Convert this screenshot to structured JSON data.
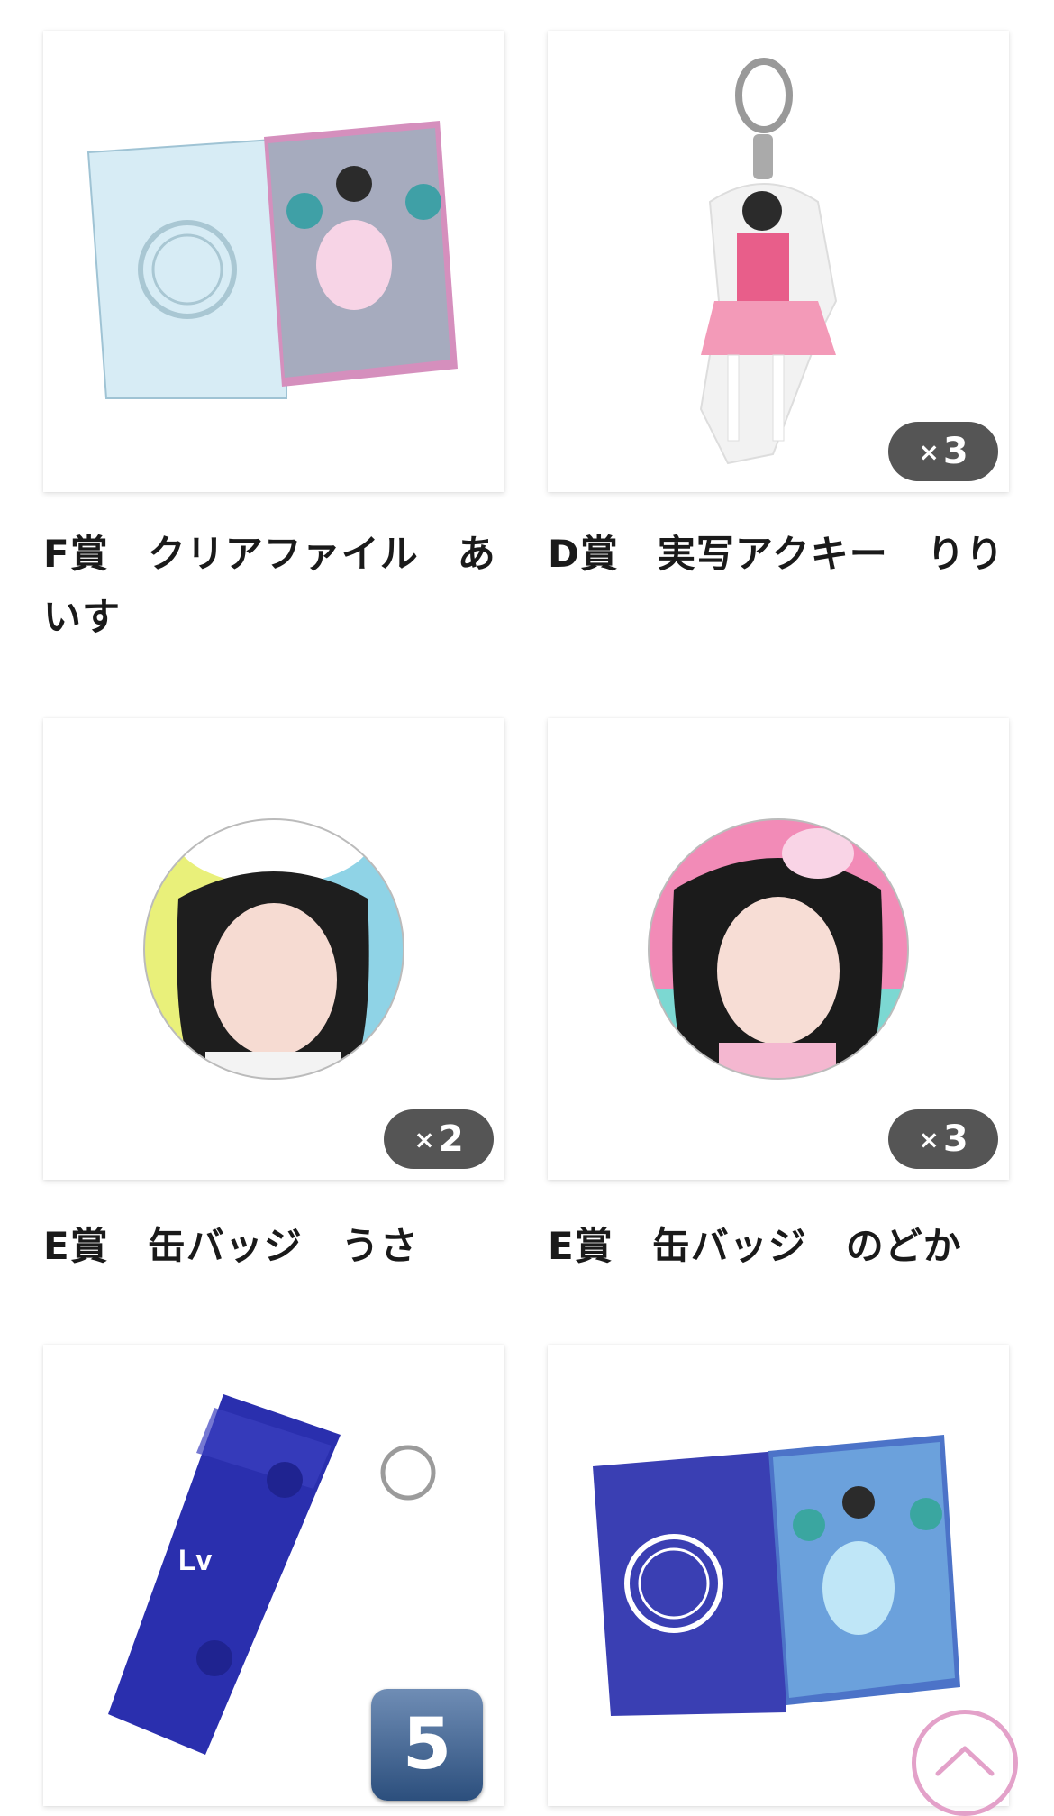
{
  "items": [
    {
      "title": "F賞　クリアファイル　あいす",
      "count": null
    },
    {
      "title": "D賞　実写アクキー　りり",
      "count": "3"
    },
    {
      "title": "E賞　缶バッジ　うさ",
      "count": "2"
    },
    {
      "title": "E賞　缶バッジ　のどか",
      "count": "3"
    },
    {
      "title": "",
      "count": null
    },
    {
      "title": "",
      "count": null
    }
  ],
  "badge_prefix": "×",
  "page_indicator": "5",
  "colors": {
    "badge_bg": "#555555",
    "scroll_top_ring": "#e3a1c9"
  },
  "icons": {
    "scroll_top": "chevron-up-icon"
  }
}
